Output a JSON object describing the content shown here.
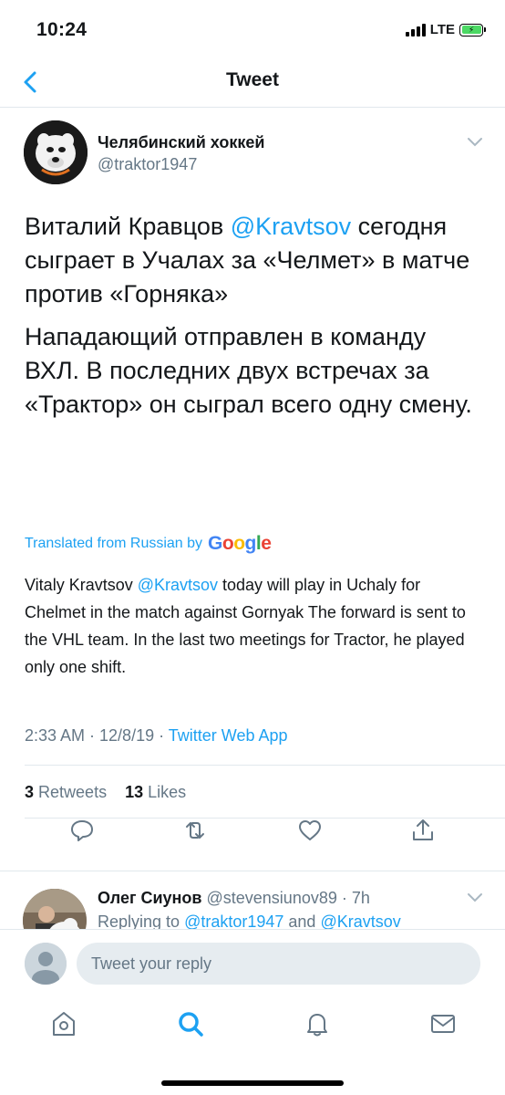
{
  "status_bar": {
    "time": "10:24",
    "network": "LTE",
    "battery_level": 1.0
  },
  "nav": {
    "title": "Tweet"
  },
  "tweet": {
    "author_name": "Челябинский хоккей",
    "author_handle": "@traktor1947",
    "text_p1_a": "Виталий Кравцов ",
    "text_p1_mention": "@Kravtsov",
    "text_p1_b": " сегодня сыграет в Учалах за «Челмет» в матче против «Горняка»",
    "text_p2": "Нападающий отправлен в команду ВХЛ. В последних двух встречах за «Трактор» он сыграл всего одну смену.",
    "translated_label": "Translated from Russian by",
    "translated_provider": "Google",
    "translation_a": "Vitaly Kravtsov ",
    "translation_mention": "@Kravtsov",
    "translation_b": " today will play in Uchaly for Chelmet in the match against Gornyak The forward is sent to the VHL team. In the last two meetings for Tractor, he played only one shift.",
    "timestamp": "2:33 AM · 12/8/19 · ",
    "source_app": "Twitter Web App",
    "retweets_count": "3",
    "retweets_label": "Retweets",
    "likes_count": "13",
    "likes_label": "Likes"
  },
  "reply": {
    "name": "Олег Сиунов",
    "handle_time": "@stevensiunov89 · 7h",
    "replying_prefix": "Replying to ",
    "replying_to_1": "@traktor1947",
    "replying_and": " and ",
    "replying_to_2": "@Kravtsov"
  },
  "compose": {
    "placeholder": "Tweet your reply"
  },
  "tabs": [
    "home",
    "search",
    "notifications",
    "messages"
  ],
  "colors": {
    "accent": "#1da1f2",
    "secondary_text": "#657786",
    "divider": "#e1e8ed"
  }
}
